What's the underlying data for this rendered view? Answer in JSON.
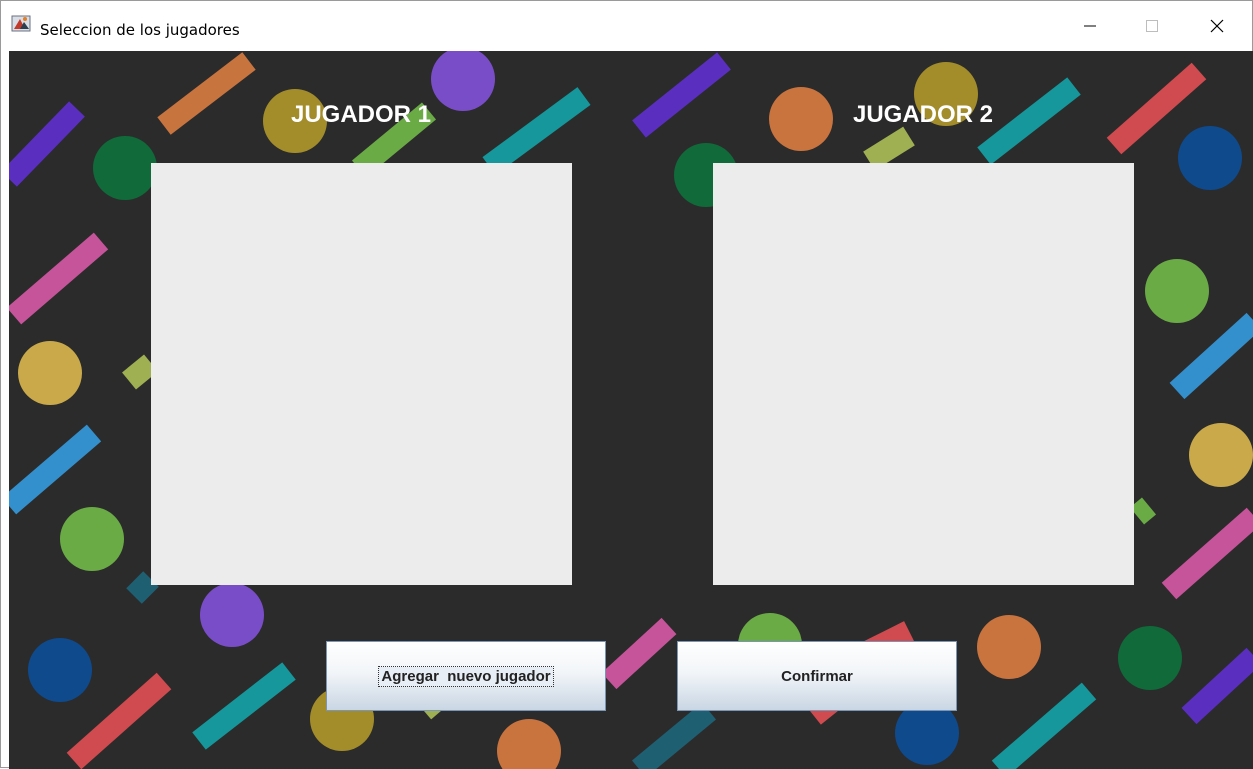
{
  "window": {
    "title": "Seleccion de los jugadores"
  },
  "titlebar_icons": [
    "java-app-icon",
    "minimize-icon",
    "maximize-icon",
    "close-icon"
  ],
  "players": [
    {
      "label": "JUGADOR 1"
    },
    {
      "label": "JUGADOR 2"
    }
  ],
  "buttons": {
    "add_player": "Agregar  nuevo jugador",
    "confirm": "Confirmar"
  },
  "colors": {
    "background": "#2b2b2b",
    "panel": "#ececec",
    "label_text": "#ffffff"
  }
}
